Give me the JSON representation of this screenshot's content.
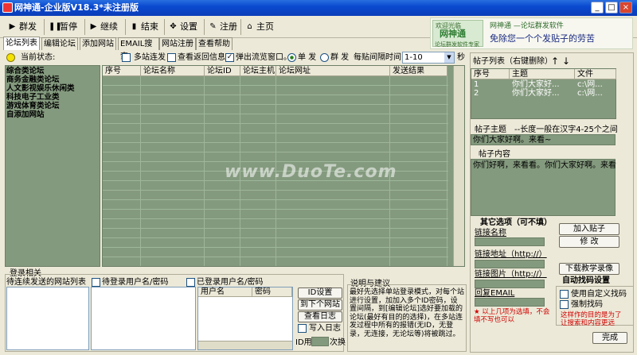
{
  "window": {
    "title": "网神通-企业版V18.3*未注册版"
  },
  "toolbar": {
    "items": [
      {
        "label": "群发",
        "icon": "play-icon"
      },
      {
        "label": "暂停",
        "icon": "pause-icon"
      },
      {
        "label": "继续",
        "icon": "resume-icon"
      },
      {
        "label": "结束",
        "icon": "stop-icon"
      },
      {
        "label": "设置",
        "icon": "settings-icon"
      },
      {
        "label": "注册",
        "icon": "pencil-icon"
      },
      {
        "label": "主页",
        "icon": "home-icon"
      }
    ]
  },
  "banner": {
    "brand_top": "欢迎光临",
    "brand_name": "网神通",
    "brand_sub": "论坛群发软件专家",
    "line1": "网神通 —论坛群发软件",
    "line2": "免除您一个个发贴子的劳苦"
  },
  "tabs": [
    "论坛列表",
    "编辑论坛",
    "添加网站",
    "EMAIL搜索",
    "网站注册",
    "查看帮助"
  ],
  "status": {
    "label": "当前状态:",
    "multi_site": "多站连发",
    "view_return": "查看返回信息",
    "popup_browser": "弹出流览窗口。",
    "single": "单 发",
    "group": "群 发",
    "interval_label": "每贴间隔时间",
    "interval_value": "1-10",
    "seconds": "秒"
  },
  "categories": [
    "综合类论坛",
    "商务金融类论坛",
    "人文影视娱乐休闲类",
    "科技电子工业类",
    "游戏体育类论坛",
    "自添加网站"
  ],
  "forum_table": {
    "columns": [
      "序号",
      "论坛名称",
      "论坛ID",
      "论坛主机",
      "论坛网址",
      "发送结果"
    ]
  },
  "post_list": {
    "title": "帖子列表（右键删除）",
    "columns": [
      "序号",
      "主题",
      "文件"
    ],
    "rows": [
      {
        "num": "1",
        "subject": "你们大家好...",
        "file": "c:\\网..."
      },
      {
        "num": "2",
        "subject": "你们大家好...",
        "file": "c:\\网..."
      }
    ]
  },
  "post_subject": {
    "label": "帖子主题",
    "hint": "--长度一般在汉字4-25个之间",
    "value": "你们大家好啊。来看~"
  },
  "post_content": {
    "label": "帖子内容",
    "value": "你们好啊，来看看。你们大家好啊。来看"
  },
  "other_options": {
    "title": "其它选项（可不填）",
    "link_name": "链接名称",
    "link_url": "链接地址（http://）",
    "link_image": "链接图片（http://）",
    "reply_email": "回复EMAIL",
    "add_post": "加入贴子",
    "edit": "修 改",
    "download_video": "下载教学录像"
  },
  "auto_captcha": {
    "title": "自动找码设置",
    "use_custom": "使用自定义找码",
    "force": "强制找码",
    "note_left": "★ 以上几项为选填，不会填不写也可以",
    "note_right": "这样作的目的是为了让搜索和内容更远",
    "done": "完成"
  },
  "login": {
    "title": "登录相关",
    "pending_sites": "待连续发送的网站列表",
    "pending_user": "待登录用户名/密码",
    "logged_user": "已登录用户名/密码",
    "user_col": "用户名",
    "pass_col": "密码",
    "id_settings": "ID设置",
    "next_site": "到下个网站",
    "view_log": "查看日志",
    "write_log": "写入日志",
    "id_used": "ID用",
    "times": "次换"
  },
  "help": {
    "title": "说明与建议",
    "text": "最好先选择单站登录模式，对每个站进行设置，加加入多个ID密码，设置间隔，到[编辑论坛]选好要加载的论坛(最好有目的的选择)，在多站连发过程中所有的报错(无ID，无登录，无连接，无论坛等)将被跳过。"
  },
  "watermark": "www.DuoTe.com",
  "colors": {
    "panel_green": "#849a7e",
    "titlebar": "#0a4ad0",
    "accent_red": "#d00000"
  }
}
